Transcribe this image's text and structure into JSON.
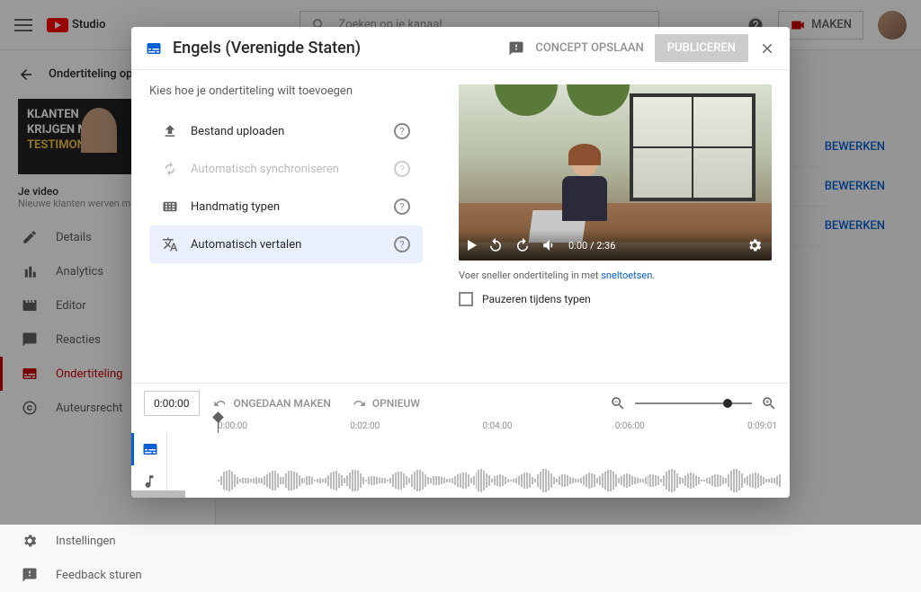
{
  "topbar": {
    "logo": "Studio",
    "search_placeholder": "Zoeken op je kanaal",
    "make": "MAKEN"
  },
  "sidebar": {
    "back_title": "Ondertiteling op je kanaal",
    "thumb_line1": "KLANTEN",
    "thumb_line2": "KRIJGEN MET",
    "thumb_line3": "TESTIMONIALS",
    "vid_label": "Je video",
    "vid_sub": "Nieuwe klanten werven met video t",
    "items": [
      {
        "label": "Details"
      },
      {
        "label": "Analytics"
      },
      {
        "label": "Editor"
      },
      {
        "label": "Reacties"
      },
      {
        "label": "Ondertiteling"
      },
      {
        "label": "Auteursrecht"
      }
    ],
    "footer": [
      {
        "label": "Instellingen"
      },
      {
        "label": "Feedback sturen"
      }
    ]
  },
  "content": {
    "edit": "BEWERKEN"
  },
  "dialog": {
    "title": "Engels (Verenigde Staten)",
    "concept": "CONCEPT OPSLAAN",
    "publish": "PUBLICEREN",
    "choose": "Kies hoe je ondertiteling wilt toevoegen",
    "opts": [
      {
        "label": "Bestand uploaden"
      },
      {
        "label": "Automatisch synchroniseren"
      },
      {
        "label": "Handmatig typen"
      },
      {
        "label": "Automatisch vertalen"
      }
    ],
    "time": "0:00 / 2:36",
    "hint_pre": "Voer sneller ondertiteling in met ",
    "hint_link": "sneltoetsen",
    "hint_post": ".",
    "pause": "Pauzeren tijdens typen",
    "timecode": "0:00:00",
    "undo": "ONGEDAAN MAKEN",
    "redo": "OPNIEUW",
    "ruler": [
      "0:00:00",
      "0:02:00",
      "0:04:00",
      "0:06:00",
      "0:09:01"
    ]
  }
}
